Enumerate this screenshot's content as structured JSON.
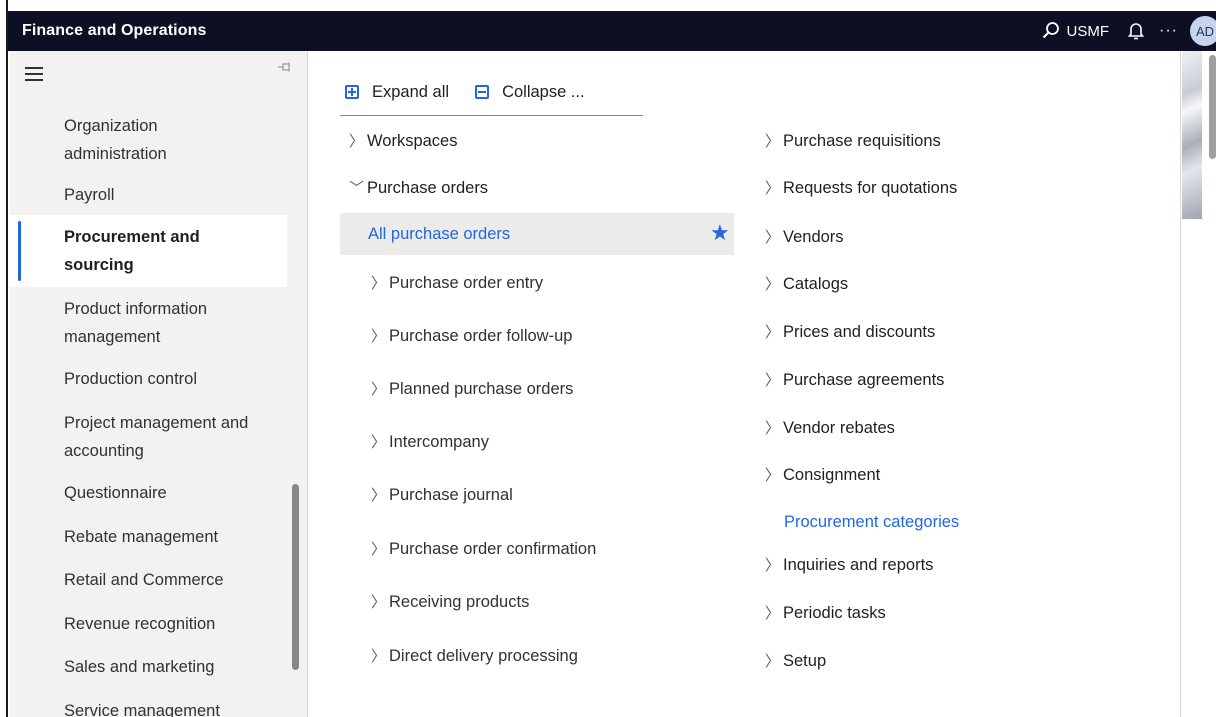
{
  "app": {
    "title": "Finance and Operations",
    "company": "USMF",
    "more_label": "···",
    "avatar_initials": "AD"
  },
  "sidebar": {
    "items": [
      {
        "label": "Organization administration",
        "selected": false
      },
      {
        "label": "Payroll",
        "selected": false
      },
      {
        "label": "Procurement and sourcing",
        "selected": true
      },
      {
        "label": "Product information management",
        "selected": false
      },
      {
        "label": "Production control",
        "selected": false
      },
      {
        "label": "Project management and accounting",
        "selected": false
      },
      {
        "label": "Questionnaire",
        "selected": false
      },
      {
        "label": "Rebate management",
        "selected": false
      },
      {
        "label": "Retail and Commerce",
        "selected": false
      },
      {
        "label": "Revenue recognition",
        "selected": false
      },
      {
        "label": "Sales and marketing",
        "selected": false
      },
      {
        "label": "Service management",
        "selected": false
      }
    ]
  },
  "toolbar": {
    "expand_label": "Expand all",
    "collapse_label": "Collapse ..."
  },
  "menu_left": {
    "workspaces": "Workspaces",
    "purchase_orders": "Purchase orders",
    "all_purchase_orders": "All purchase orders",
    "subitems": [
      "Purchase order entry",
      "Purchase order follow-up",
      "Planned purchase orders",
      "Intercompany",
      "Purchase journal",
      "Purchase order confirmation",
      "Receiving products",
      "Direct delivery processing"
    ]
  },
  "menu_right": {
    "items": [
      "Purchase requisitions",
      "Requests for quotations",
      "Vendors",
      "Catalogs",
      "Prices and discounts",
      "Purchase agreements",
      "Vendor rebates",
      "Consignment"
    ],
    "link": "Procurement categories",
    "items_after": [
      "Inquiries and reports",
      "Periodic tasks",
      "Setup"
    ]
  },
  "colors": {
    "accent": "#2266e3",
    "topbar": "#0d1025",
    "sidebar_bg": "#f3f2f1",
    "highlight_bg": "#edebe9"
  },
  "icons": {
    "search": "search-icon",
    "bell": "bell-icon",
    "star": "favorite-star-icon",
    "chevron": "chevron-right-icon"
  }
}
